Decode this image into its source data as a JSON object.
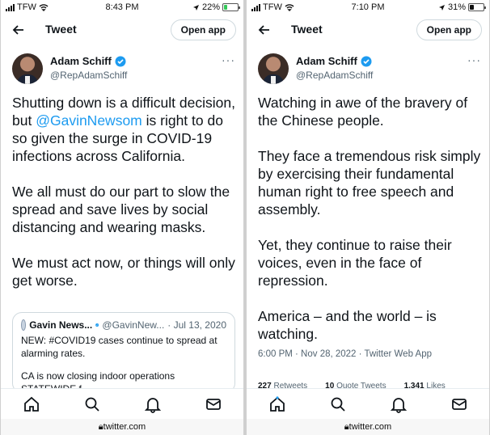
{
  "left": {
    "status": {
      "carrier": "TFW",
      "time": "8:43 PM",
      "battery": "22%",
      "battery_level": 0.22,
      "battery_color": "#34c759"
    },
    "header": {
      "title": "Tweet",
      "open_app_label": "Open app"
    },
    "author": {
      "name": "Adam Schiff",
      "handle": "@RepAdamSchiff"
    },
    "tweet": {
      "p1_before": "Shutting down is a difficult decision, but ",
      "p1_mention": "@GavinNewsom",
      "p1_after": " is right to do so given the surge in COVID-19 infections across California.",
      "p2": "We all must do our part to slow the spread and save lives by social distancing and wearing masks.",
      "p3": "We must act now, or things will only get worse."
    },
    "quote": {
      "name": "Gavin News...",
      "handle": "@GavinNew...",
      "date": "· Jul 13, 2020",
      "text1": "NEW: #COVID19 cases continue to spread at alarming rates.",
      "text2": "CA is now closing indoor operations STATEWIDE f"
    },
    "url": "twitter.com"
  },
  "right": {
    "status": {
      "carrier": "TFW",
      "time": "7:10 PM",
      "battery": "31%",
      "battery_level": 0.31,
      "battery_color": "#111111"
    },
    "header": {
      "title": "Tweet",
      "open_app_label": "Open app"
    },
    "author": {
      "name": "Adam Schiff",
      "handle": "@RepAdamSchiff"
    },
    "tweet": {
      "p1": "Watching in awe of the bravery of the Chinese people.",
      "p2": "They face a tremendous risk simply by exercising their fundamental human right to free speech and assembly.",
      "p3": "Yet, they continue to raise their voices, even in the face of repression.",
      "p4": "America – and the world – is watching."
    },
    "meta": "6:00 PM · Nov 28, 2022 · Twitter Web App",
    "stats": {
      "retweets": "227",
      "retweets_label": "Retweets",
      "quotes": "10",
      "quotes_label": "Quote Tweets",
      "likes": "1,341",
      "likes_label": "Likes"
    },
    "url": "twitter.com"
  },
  "colors": {
    "accent": "#1d9bf0",
    "text": "#0f1419",
    "secondary": "#536471"
  },
  "icons": [
    "back-arrow-icon",
    "verified-badge-icon",
    "more-icon",
    "home-icon",
    "search-icon",
    "notifications-bell-icon",
    "messages-mail-icon",
    "lock-icon"
  ]
}
